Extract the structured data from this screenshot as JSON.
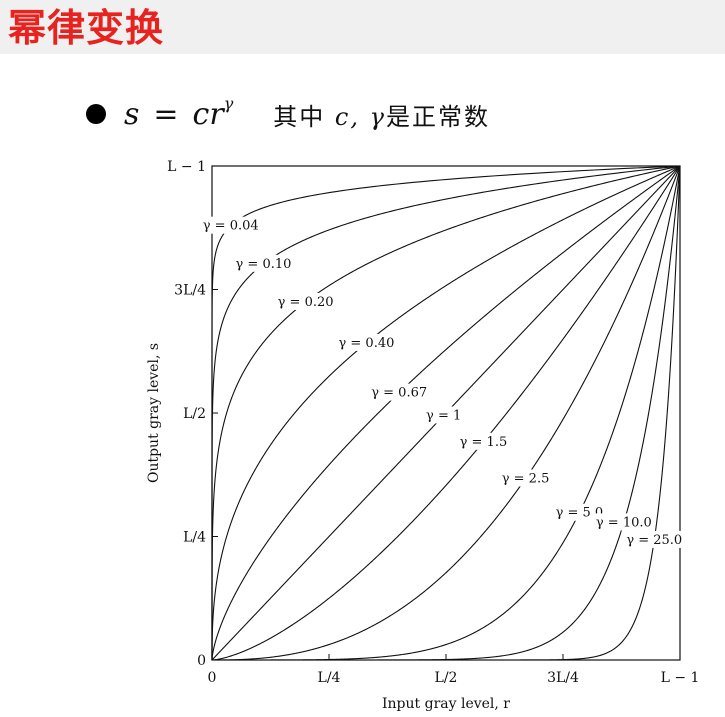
{
  "slide": {
    "title": "幂律变换",
    "formula": {
      "s": "s",
      "equals": "=",
      "c": "c",
      "r": "r",
      "gamma_sup": "γ"
    },
    "note_prefix": "其中 ",
    "note_vars": "c, γ",
    "note_suffix": "是正常数"
  },
  "chart_data": {
    "type": "line",
    "xlabel": "Input gray level, r",
    "ylabel": "Output gray level, s",
    "x_ticks": [
      "0",
      "L/4",
      "L/2",
      "3L/4",
      "L − 1"
    ],
    "y_ticks": [
      "0",
      "L/4",
      "L/2",
      "3L/4",
      "L − 1"
    ],
    "xlim": [
      0,
      1
    ],
    "ylim": [
      0,
      1
    ],
    "series": [
      {
        "name": "γ = 0.04",
        "gamma": 0.04,
        "label_at": 0.04
      },
      {
        "name": "γ = 0.10",
        "gamma": 0.1,
        "label_at": 0.11
      },
      {
        "name": "γ = 0.20",
        "gamma": 0.2,
        "label_at": 0.2
      },
      {
        "name": "γ = 0.40",
        "gamma": 0.4,
        "label_at": 0.33
      },
      {
        "name": "γ = 0.67",
        "gamma": 0.67,
        "label_at": 0.4
      },
      {
        "name": "γ = 1",
        "gamma": 1.0,
        "label_at": 0.495
      },
      {
        "name": "γ = 1.5",
        "gamma": 1.5,
        "label_at": 0.58
      },
      {
        "name": "γ = 2.5",
        "gamma": 2.5,
        "label_at": 0.67
      },
      {
        "name": "γ = 5.0",
        "gamma": 5.0,
        "label_at": 0.785
      },
      {
        "name": "γ = 10.0",
        "gamma": 10.0,
        "label_at": 0.88
      },
      {
        "name": "γ = 25.0",
        "gamma": 25.0,
        "label_at": 0.945
      }
    ]
  }
}
